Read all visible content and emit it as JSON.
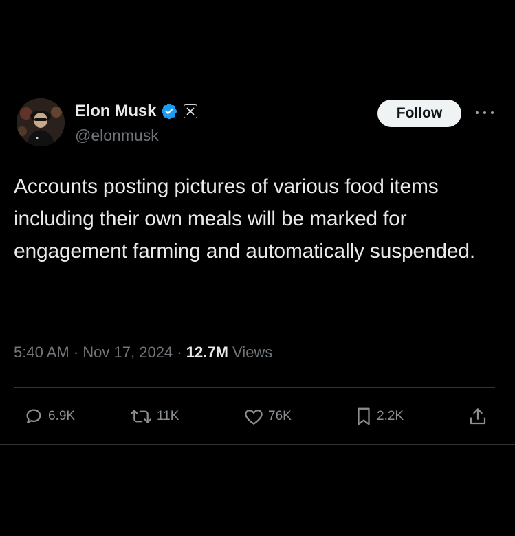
{
  "author": {
    "display_name": "Elon Musk",
    "handle": "@elonmusk",
    "verified_color": "#1d9bf0",
    "affiliate_badge": "𝕏"
  },
  "follow_label": "Follow",
  "tweet": {
    "text": "Accounts posting pictures of various food items including their own meals will be marked for engagement farming and automatically suspended."
  },
  "meta": {
    "time": "5:40 AM",
    "separator": "·",
    "date": "Nov 17, 2024",
    "views_count": "12.7M",
    "views_label": "Views"
  },
  "actions": {
    "replies": "6.9K",
    "reposts": "11K",
    "likes": "76K",
    "bookmarks": "2.2K"
  },
  "icons": {
    "reply": "reply-icon",
    "repost": "repost-icon",
    "like": "heart-icon",
    "bookmark": "bookmark-icon",
    "share": "share-icon",
    "more": "more-icon",
    "verified": "verified-badge-icon"
  },
  "colors": {
    "background": "#000000",
    "text_primary": "#e7e9ea",
    "text_secondary": "#71767b",
    "follow_bg": "#eff3f4",
    "divider": "#2f3336"
  }
}
